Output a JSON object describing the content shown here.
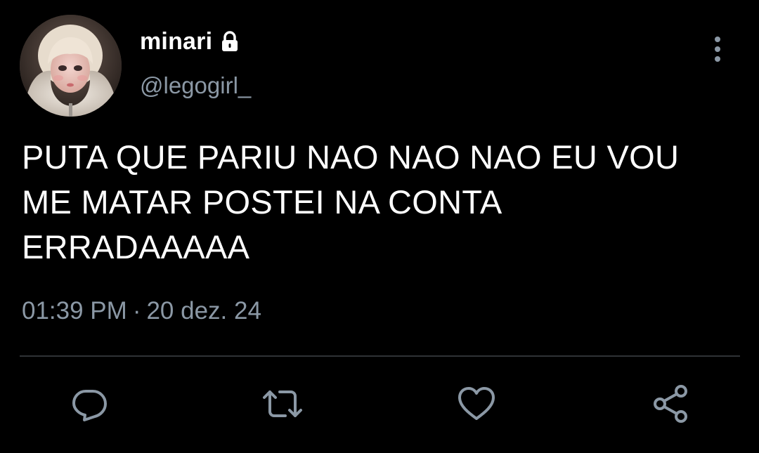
{
  "tweet": {
    "display_name": "minari",
    "handle": "@legogirl_",
    "protected": true,
    "avatar_icon": "avatar",
    "text_lines": [
      "PUTA QUE PARIU NAO NAO NAO EU VOU",
      "ME MATAR POSTEI NA CONTA",
      "ERRADAAAAA"
    ],
    "time": "01:39 PM",
    "separator": "·",
    "date": "20 dez. 24"
  },
  "icons": {
    "lock": "lock-icon",
    "more": "more-vertical-icon",
    "reply": "reply-icon",
    "retweet": "retweet-icon",
    "like": "heart-icon",
    "share": "share-icon"
  },
  "colors": {
    "background": "#000000",
    "primary_text": "#ffffff",
    "secondary_text": "#8b98a5",
    "divider": "#2f3336"
  }
}
